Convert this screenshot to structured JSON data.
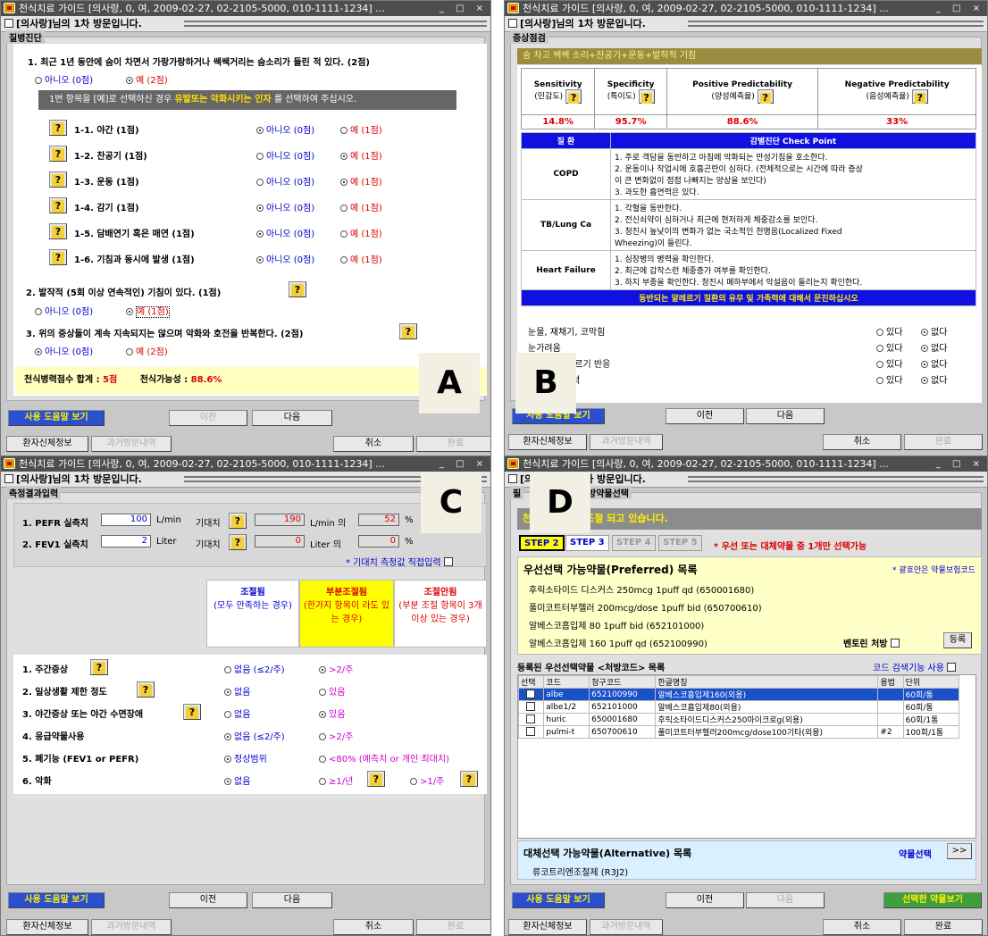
{
  "window_title": "천식치료 가이드 [의사랑, 0, 여, 2009-02-27, 02-2105-5000, 010-1111-1234] ...",
  "window_controls": "_ □ ×",
  "visit_header": "[의사랑]님의 1차 방문입니다.",
  "labels": {
    "a": "A",
    "b": "B",
    "c": "C",
    "d": "D"
  },
  "bottom": {
    "help": "사용 도움말 보기",
    "prev": "이전",
    "next": "다음",
    "patient_info": "환자신체정보",
    "past_visits": "과거방문내역",
    "cancel": "취소",
    "done": "완료",
    "selected_drugs": "선택한 약물보기"
  },
  "a": {
    "panel_title": "질병진단",
    "q1": "1. 최근 1년 동안에 숨이 차면서 가랑가랑하거나 쌕쌕거리는 숨소리가 들린 적 있다. (2점)",
    "q1_no": "아니오 (0점)",
    "q1_yes": "예 (2점)",
    "note_pre": "1번 항목을 [예]로 선택하신 경우",
    "note_hl": "유발또는 악화시키는 인자",
    "note_post": "를 선택하여 주십시오.",
    "items": [
      {
        "label": "1-1. 야간 (1점)",
        "no": "아니오 (0점)",
        "yes": "예 (1점)"
      },
      {
        "label": "1-2. 찬공기 (1점)",
        "no": "아니오 (0점)",
        "yes": "예 (1점)"
      },
      {
        "label": "1-3. 운동 (1점)",
        "no": "아니오 (0점)",
        "yes": "예 (1점)"
      },
      {
        "label": "1-4. 감기 (1점)",
        "no": "아니오 (0점)",
        "yes": "예 (1점)"
      },
      {
        "label": "1-5. 담배연기 혹은 매연 (1점)",
        "no": "아니오 (0점)",
        "yes": "예 (1점)"
      },
      {
        "label": "1-6. 기침과 동시에 발생 (1점)",
        "no": "아니오 (0점)",
        "yes": "예 (1점)"
      }
    ],
    "q2": "2. 발작적 (5회 이상 연속적인) 기침이 있다. (1점)",
    "q2_no": "아니오 (0점)",
    "q2_yes": "예 (1점)",
    "q3": "3. 위의 증상들이 계속 지속되지는 않으며 악화와 호전을 반복한다. (2점)",
    "q3_no": "아니오 (0점)",
    "q3_yes": "예 (2점)",
    "score_label": "천식병력점수 합계 :",
    "score_value": "5점",
    "prob_label": "천식가능성 :",
    "prob_value": "88.6%"
  },
  "b": {
    "panel_title": "증상점검",
    "banner": "숨 차고 쌕쌕 소리+찬공기+운동+발작적 기침",
    "stats": [
      {
        "name": "Sensitivity",
        "kor": "(민감도)",
        "value": "14.8%"
      },
      {
        "name": "Specificity",
        "kor": "(특이도)",
        "value": "95.7%"
      },
      {
        "name": "Positive Predictability",
        "kor": "(양성예측율)",
        "value": "88.6%"
      },
      {
        "name": "Negative Predictability",
        "kor": "(음성예측율)",
        "value": "33%"
      }
    ],
    "cp_head_disease": "질 환",
    "cp_head_check": "감별진단 Check Point",
    "cp_rows": [
      {
        "disease": "COPD",
        "points": [
          "1. 주로 객담을 동반하고 아침에 악화되는 만성기침을 호소한다.",
          "2. 운동이나 작업시에 호흡곤란이 심하다. (전체적으로는 시간에 따라 증상",
          "이 큰 변화없이 점점 나빠지는 양상을 보인다)",
          "3. 과도한 흡연력은 있다."
        ]
      },
      {
        "disease": "TB/Lung Ca",
        "points": [
          "1. 각혈을 동반한다.",
          "2. 전신쇠약이 심하거나 최근에 현저하게 체중감소를 보인다.",
          "3. 청진시 높낮이의 변화가 없는 국소적인 천명음(Localized Fixed",
          "Wheezing)이 들린다."
        ]
      },
      {
        "disease": "Heart Failure",
        "points": [
          "1. 심장병의 병력을 확인한다.",
          "2. 최근에 갑작스런 체중증가 여부를 확인한다.",
          "3. 하지 부종을 확인한다. 청진시 폐하부에서 악설음이 들리는지 확인한다."
        ]
      }
    ],
    "allergy_banner": "동반되는 알레르기 질환의 유무 및 가족력에 대해서 문진하십시오",
    "allergy": [
      {
        "label": "눈물, 재채기, 코막힘",
        "yes": "있다",
        "no": "없다"
      },
      {
        "label": "눈가려움",
        "yes": "있다",
        "no": "없다"
      },
      {
        "label": "에 대한 알레르기 반응",
        "yes": "있다",
        "no": "없다"
      },
      {
        "label": "질환의 가족력",
        "yes": "있다",
        "no": "없다"
      }
    ]
  },
  "c": {
    "panel_title": "측정결과입력",
    "pefr_label": "1. PEFR 실측치",
    "pefr_value": "100",
    "pefr_unit": "L/min",
    "pefr_expected_label": "기대치",
    "pefr_expected": "190",
    "pefr_expected_unit": "L/min 의",
    "pefr_pct": "52",
    "fev1_label": "2. FEV1 실측치",
    "fev1_value": "2",
    "fev1_unit": "Liter",
    "fev1_expected_label": "기대치",
    "fev1_expected": "0",
    "fev1_expected_unit": "Liter 의",
    "fev1_pct": "0",
    "pct": "%",
    "direct_input": "* 기대치 측정값 직접입력",
    "col_controlled_title": "조절됨",
    "col_controlled_sub": "(모두 만족하는 경우)",
    "col_partial_title": "부분조절됨",
    "col_partial_sub": "(한가지 항목이 라도 있는 경우)",
    "col_uncontrolled_title": "조절안됨",
    "col_uncontrolled_sub": "(부분 조절 항목이 3개 이상 있는 경우)",
    "rows": [
      {
        "label": "1. 주간증상",
        "o1": "없음 (≤2/주)",
        "o2": ">2/주"
      },
      {
        "label": "2. 일상생활 제한 정도",
        "o1": "없음",
        "o2": "있음"
      },
      {
        "label": "3. 야간증상 또는 야간 수면장애",
        "o1": "없음",
        "o2": "있음"
      },
      {
        "label": "4. 응급약물사용",
        "o1": "없음 (≤2/주)",
        "o2": ">2/주"
      },
      {
        "label": "5. 폐기능 (FEV1 or PEFR)",
        "o1": "정상범위",
        "o2": "<80% (예측치 or 개인 최대치)"
      },
      {
        "label": "6. 악화",
        "o1": "없음",
        "o2": "≥1/년",
        "o3": ">1/주"
      }
    ]
  },
  "d": {
    "panel_title": "방약물선택",
    "panel_prefix": "필",
    "status_prefix": "천",
    "status": "조절 되고 있습니다.",
    "steps": [
      "STEP 2",
      "STEP 3",
      "STEP 4",
      "STEP 5"
    ],
    "step_note": "* 우선 또는 대체약물 중 1개만 선택가능",
    "preferred_title": "우선선택 가능약물(Preferred) 목록",
    "preferred_note": "* 괄호안은 약물보험코드",
    "preferred": [
      "후릭소타이드 디스커스 250mcg 1puff qd (650001680)",
      "풀미코트터부헬러 200mcg/dose 1puff bid (650700610)",
      "알베스코흡입제 80 1puff bid (652101000)",
      "알베스코흡입제 160 1puff qd (652100990)"
    ],
    "ventolin": "벤토린 처방",
    "register": "등록",
    "registered_title": "등록된 우선선택약물 <처방코드> 목록",
    "code_search": "코드 검색기능 사용",
    "table_headers": [
      "선택",
      "코드",
      "청구코드",
      "한글명칭",
      "용법",
      "단위"
    ],
    "table_rows": [
      [
        "albe",
        "652100990",
        "알베스코흡입제160(외용)",
        "",
        "60회/통"
      ],
      [
        "albe1/2",
        "652101000",
        "알베스코흡입제80(외용)",
        "",
        "60회/통"
      ],
      [
        "huric",
        "650001680",
        "후릭소타이드디스커스250마이크로g(외용)",
        "",
        "60회/1통"
      ],
      [
        "pulmi-t",
        "650700610",
        "풀미코트터부헬러200mcg/dose100기타(외용)",
        "#2",
        "100회/1통"
      ]
    ],
    "alt_title": "대체선택 가능약물(Alternative) 목록",
    "alt_select": "약물선택",
    "alt_arrow": ">>",
    "alt_item": "류코트리엔조절제 (R3J2)"
  }
}
